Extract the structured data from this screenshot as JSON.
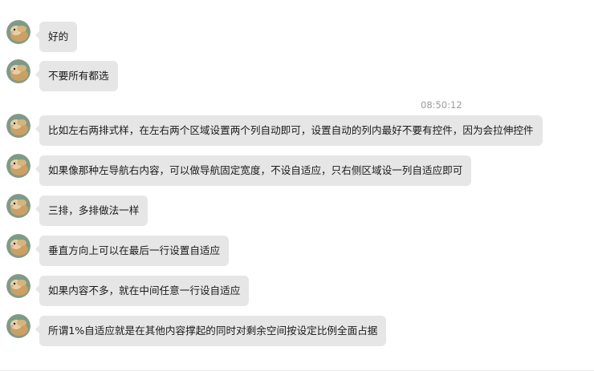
{
  "colors": {
    "bubble_bg": "#e6e6e6",
    "timestamp": "#9a9a9a",
    "background": "#ffffff"
  },
  "timestamp": "08:50:12",
  "messages": [
    {
      "text": "好的",
      "avatar_icon": "hamster-avatar-icon"
    },
    {
      "text": "不要所有都选",
      "avatar_icon": "hamster-avatar-icon"
    },
    {
      "text": "比如左右两排式样，在左右两个区域设置两个列自动即可，设置自动的列内最好不要有控件，因为会拉伸控件",
      "avatar_icon": "hamster-avatar-icon"
    },
    {
      "text": "如果像那种左导航右内容，可以做导航固定宽度，不设自适应，只右侧区域设一列自适应即可",
      "avatar_icon": "hamster-avatar-icon"
    },
    {
      "text": "三排，多排做法一样",
      "avatar_icon": "hamster-avatar-icon"
    },
    {
      "text": "垂直方向上可以在最后一行设置自适应",
      "avatar_icon": "hamster-avatar-icon"
    },
    {
      "text": "如果内容不多，就在中间任意一行设自适应",
      "avatar_icon": "hamster-avatar-icon"
    },
    {
      "text": "所谓1%自适应就是在其他内容撑起的同时对剩余空间按设定比例全面占据",
      "avatar_icon": "hamster-avatar-icon"
    }
  ]
}
